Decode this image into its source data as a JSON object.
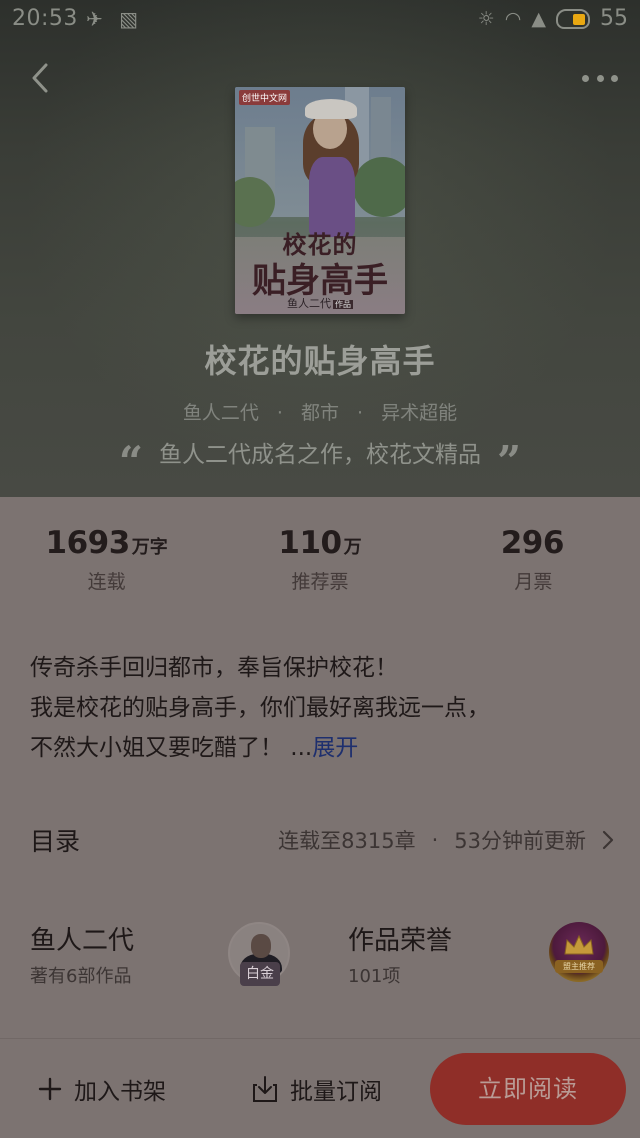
{
  "status_bar": {
    "time": "20:53",
    "battery": "55"
  },
  "cover": {
    "publisher": "创世中文网",
    "title_line1": "校花的",
    "title_line2": "贴身高手",
    "author": "鱼人二代",
    "author_tag": "作品"
  },
  "book": {
    "title": "校花的贴身高手",
    "author": "鱼人二代",
    "category": "都市",
    "subcategory": "异术超能",
    "tagline": "鱼人二代成名之作，校花文精品"
  },
  "stats": [
    {
      "value": "1693",
      "unit": "万字",
      "label": "连载"
    },
    {
      "value": "110",
      "unit": "万",
      "label": "推荐票"
    },
    {
      "value": "296",
      "unit": "",
      "label": "月票"
    }
  ],
  "synopsis": {
    "line1": "传奇杀手回归都市，奉旨保护校花！",
    "line2": "我是校花的贴身高手，你们最好离我远一点，",
    "line3": "不然大小姐又要吃醋了！",
    "ellipsis": " ...",
    "expand": "展开"
  },
  "toc": {
    "title": "目录",
    "chapters": "连载至8315章",
    "updated": "53分钟前更新"
  },
  "author_section": {
    "name": "鱼人二代",
    "works": "著有6部作品",
    "badge": "白金"
  },
  "honor_section": {
    "title": "作品荣誉",
    "count": "101项",
    "badge_label": "盟主推荐"
  },
  "bottom_bar": {
    "add_shelf": "加入书架",
    "batch_subscribe": "批量订阅",
    "read_now": "立即阅读"
  },
  "icons": {
    "back": "chevron-left-icon",
    "more": "more-dots-icon",
    "add": "plus-icon",
    "download": "download-icon",
    "toc_arrow": "chevron-right-icon"
  },
  "colors": {
    "accent": "#8f2e28",
    "link": "#1e2f6e",
    "battery": "#e9a812"
  }
}
